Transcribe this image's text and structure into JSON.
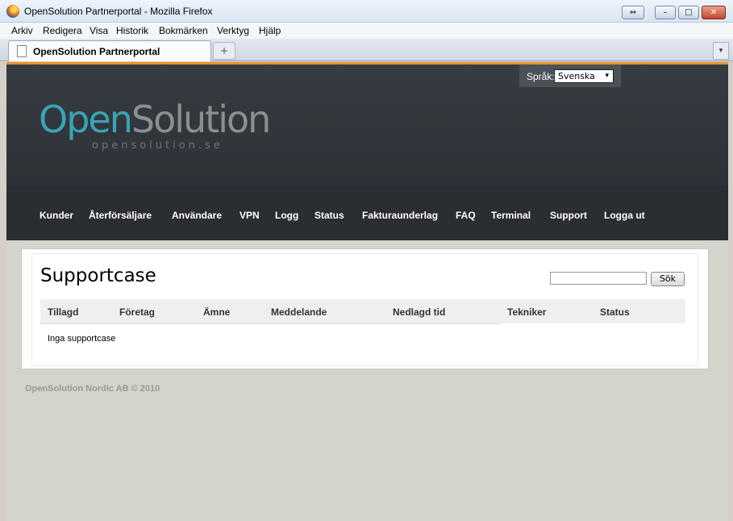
{
  "window": {
    "title": "OpenSolution Partnerportal - Mozilla Firefox",
    "back_glyph": "⇔",
    "min_glyph": "–",
    "max_glyph": "□",
    "close_glyph": "✕"
  },
  "menubar": {
    "items": [
      "Arkiv",
      "Redigera",
      "Visa",
      "Historik",
      "Bokmärken",
      "Verktyg",
      "Hjälp"
    ]
  },
  "tabs": {
    "active_label": "OpenSolution Partnerportal",
    "new_tab_glyph": "+",
    "list_glyph": "▾"
  },
  "header": {
    "language_label": "Språk:",
    "language_value": "Svenska",
    "select_arrow": "▾",
    "logo_open": "Open",
    "logo_solution": "Solution",
    "logo_sub": "opensolution.se"
  },
  "nav": {
    "items": [
      "Kunder",
      "Återförsäljare",
      "Användare",
      "VPN",
      "Logg",
      "Status",
      "Fakturaunderlag",
      "FAQ",
      "Terminal",
      "Support",
      "Logga ut"
    ]
  },
  "main": {
    "title": "Supportcase",
    "search_value": "",
    "search_button": "Sök",
    "columns": [
      "Tillagd",
      "Företag",
      "Ämne",
      "Meddelande",
      "Nedlagd tid",
      "Tekniker",
      "Status"
    ],
    "empty_text": "Inga supportcase"
  },
  "footer": {
    "text": "OpenSolution Nordic AB © 2010"
  },
  "colors": {
    "accent_orange": "#e8922e",
    "logo_teal": "#3aa3b6",
    "header_dark": "#2c3237",
    "nav_dark": "#2a2d31"
  }
}
